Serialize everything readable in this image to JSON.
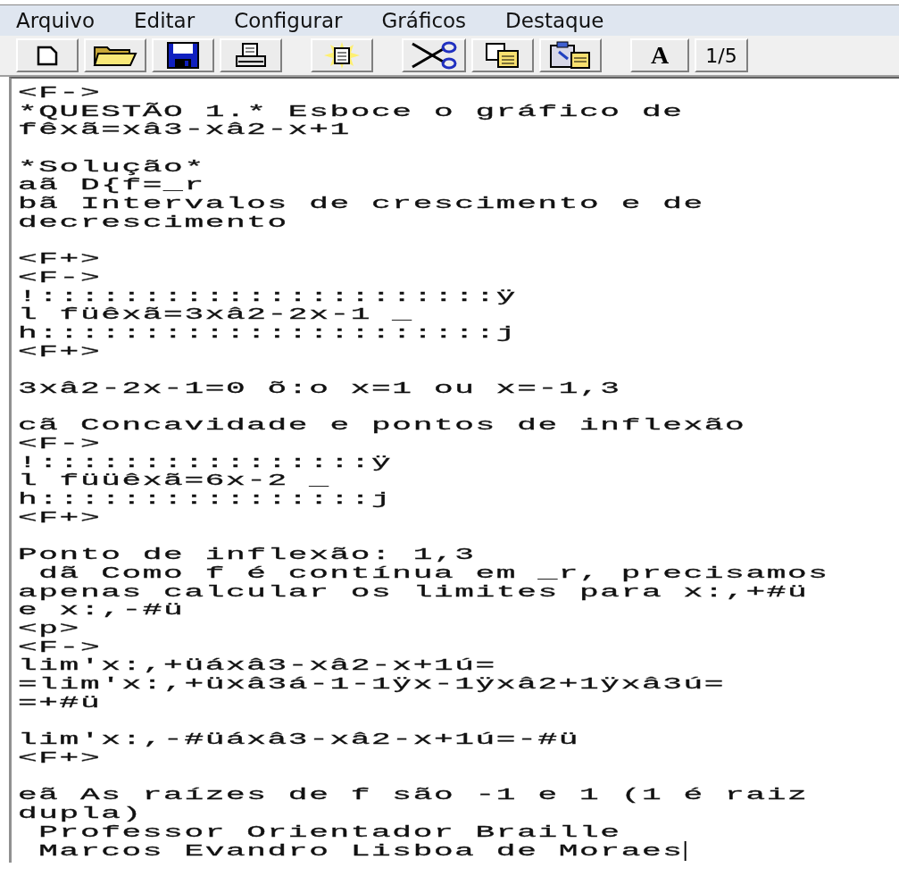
{
  "menu": [
    "Arquivo",
    "Editar",
    "Configurar",
    "Gráficos",
    "Destaque"
  ],
  "toolbar": [
    {
      "kind": "new"
    },
    {
      "kind": "open"
    },
    {
      "kind": "save"
    },
    {
      "kind": "print"
    },
    {
      "kind": "paste-special"
    },
    {
      "kind": "cut"
    },
    {
      "kind": "copy"
    },
    {
      "kind": "paste"
    },
    {
      "kind": "font",
      "label": "A"
    },
    {
      "kind": "text",
      "label": "1/5"
    }
  ],
  "editor": {
    "blocks": [
      [
        "<F->",
        "*QUESTÃO 1.* Esboce o gráfico de",
        "fêxã=xâ3-xâ2-x+1"
      ],
      [
        "*Solução*",
        "aã D{f=_r",
        "bã Intervalos de crescimento e de",
        "decrescimento"
      ],
      [
        "<F+>",
        "<F->",
        "!::::::::::::::::::::::ÿ",
        "l füêxã=3xâ2-2x-1 _",
        "h::::::::::::::::::::::j",
        "<F+>"
      ],
      [
        "3xâ2-2x-1=0 õ:o x=1 ou x=-1,3"
      ],
      [
        "cã Concavidade e pontos de inflexão",
        "<F->",
        "!::::::::::::::::ÿ",
        "l füüêxã=6x-2 _",
        "h::::::::::::::::j",
        "<F+>"
      ],
      [
        "Ponto de inflexão: 1,3",
        " dã Como f é contínua em _r, precisamos",
        "apenas calcular os limites para x:,+#ü",
        "e x:,-#ü",
        "<p>",
        "<F->",
        "lim'x:,+üáxâ3-xâ2-x+1ú=",
        "=lim'x:,+üxâ3á-1-1ÿx-1ÿxâ2+1ÿxâ3ú=",
        "=+#ü"
      ],
      [
        "lim'x:,-#üáxâ3-xâ2-x+1ú=-#ü",
        "<F+>"
      ],
      [
        "eã As raízes de f são -1 e 1 (1 é raiz",
        "dupla)",
        " Professor Orientador Braille",
        " Marcos Evandro Lisboa de Moraes"
      ]
    ]
  }
}
